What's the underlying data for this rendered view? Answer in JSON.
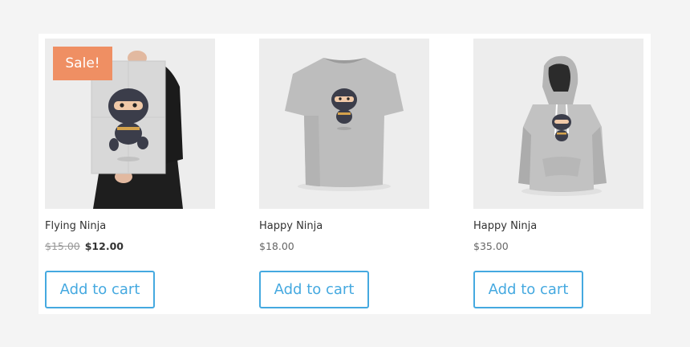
{
  "products": [
    {
      "title": "Flying Ninja",
      "badge": "Sale!",
      "price_old": "$15.00",
      "price_new": "$12.00",
      "button_label": "Add to cart",
      "image": "ninja-poster"
    },
    {
      "title": "Happy Ninja",
      "price": "$18.00",
      "button_label": "Add to cart",
      "image": "ninja-tshirt"
    },
    {
      "title": "Happy Ninja",
      "price": "$35.00",
      "button_label": "Add to cart",
      "image": "ninja-hoodie"
    }
  ],
  "colors": {
    "page_background": "#f4f4f4",
    "panel_background": "#ffffff",
    "sale_badge": "#ef8f63",
    "button_accent": "#45a9e0"
  }
}
